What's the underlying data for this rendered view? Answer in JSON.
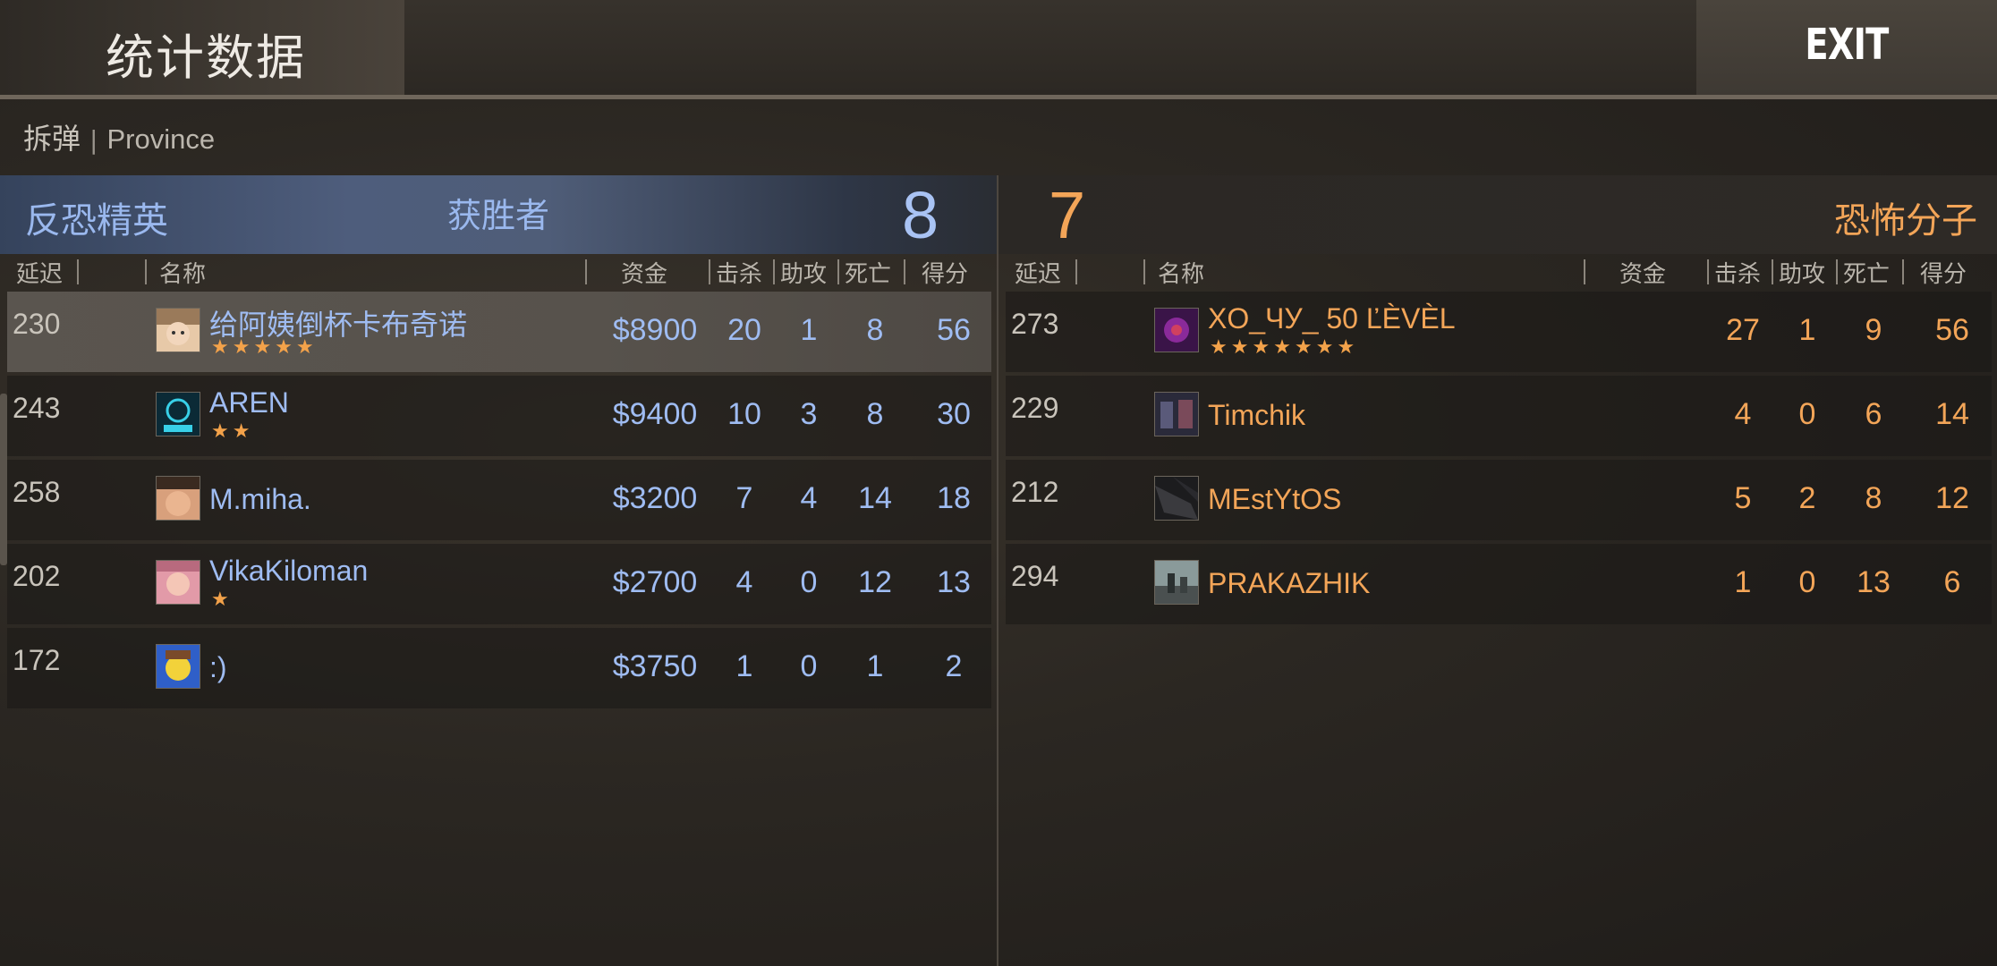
{
  "header": {
    "title": "统计数据",
    "exit_label": "EXIT"
  },
  "match": {
    "mode": "拆弹",
    "separator": "|",
    "map": "Province"
  },
  "ct": {
    "team_name": "反恐精英",
    "winner_label": "获胜者",
    "score": "8",
    "columns": {
      "ping": "延迟",
      "name": "名称",
      "money": "资金",
      "kills": "击杀",
      "assists": "助攻",
      "deaths": "死亡",
      "score": "得分"
    },
    "players": [
      {
        "ping": "230",
        "name": "给阿姨倒杯卡布奇诺",
        "stars": "★★★★★",
        "money": "$8900",
        "kills": "20",
        "assists": "1",
        "deaths": "8",
        "score": "56"
      },
      {
        "ping": "243",
        "name": "AREN",
        "stars": "★★",
        "money": "$9400",
        "kills": "10",
        "assists": "3",
        "deaths": "8",
        "score": "30"
      },
      {
        "ping": "258",
        "name": "M.miha.",
        "stars": "",
        "money": "$3200",
        "kills": "7",
        "assists": "4",
        "deaths": "14",
        "score": "18"
      },
      {
        "ping": "202",
        "name": "VikaKiloman",
        "stars": "★",
        "money": "$2700",
        "kills": "4",
        "assists": "0",
        "deaths": "12",
        "score": "13"
      },
      {
        "ping": "172",
        "name": ":)",
        "stars": "",
        "money": "$3750",
        "kills": "1",
        "assists": "0",
        "deaths": "1",
        "score": "2"
      }
    ]
  },
  "t": {
    "team_name": "恐怖分子",
    "score": "7",
    "columns": {
      "ping": "延迟",
      "name": "名称",
      "money": "资金",
      "kills": "击杀",
      "assists": "助攻",
      "deaths": "死亡",
      "score": "得分"
    },
    "players": [
      {
        "ping": "273",
        "name": "XO_ЧУ_ 50 ĽÈVÈL",
        "stars": "★★★★★★★",
        "money": "",
        "kills": "27",
        "assists": "1",
        "deaths": "9",
        "score": "56"
      },
      {
        "ping": "229",
        "name": "Timchik",
        "stars": "",
        "money": "",
        "kills": "4",
        "assists": "0",
        "deaths": "6",
        "score": "14"
      },
      {
        "ping": "212",
        "name": "MEstYtOS",
        "stars": "",
        "money": "",
        "kills": "5",
        "assists": "2",
        "deaths": "8",
        "score": "12"
      },
      {
        "ping": "294",
        "name": "PRAKAZHIK",
        "stars": "",
        "money": "",
        "kills": "1",
        "assists": "0",
        "deaths": "13",
        "score": "6"
      }
    ]
  },
  "colors": {
    "ct_accent": "#9fbcf2",
    "t_accent": "#f3a558",
    "star": "#f3a24a"
  }
}
